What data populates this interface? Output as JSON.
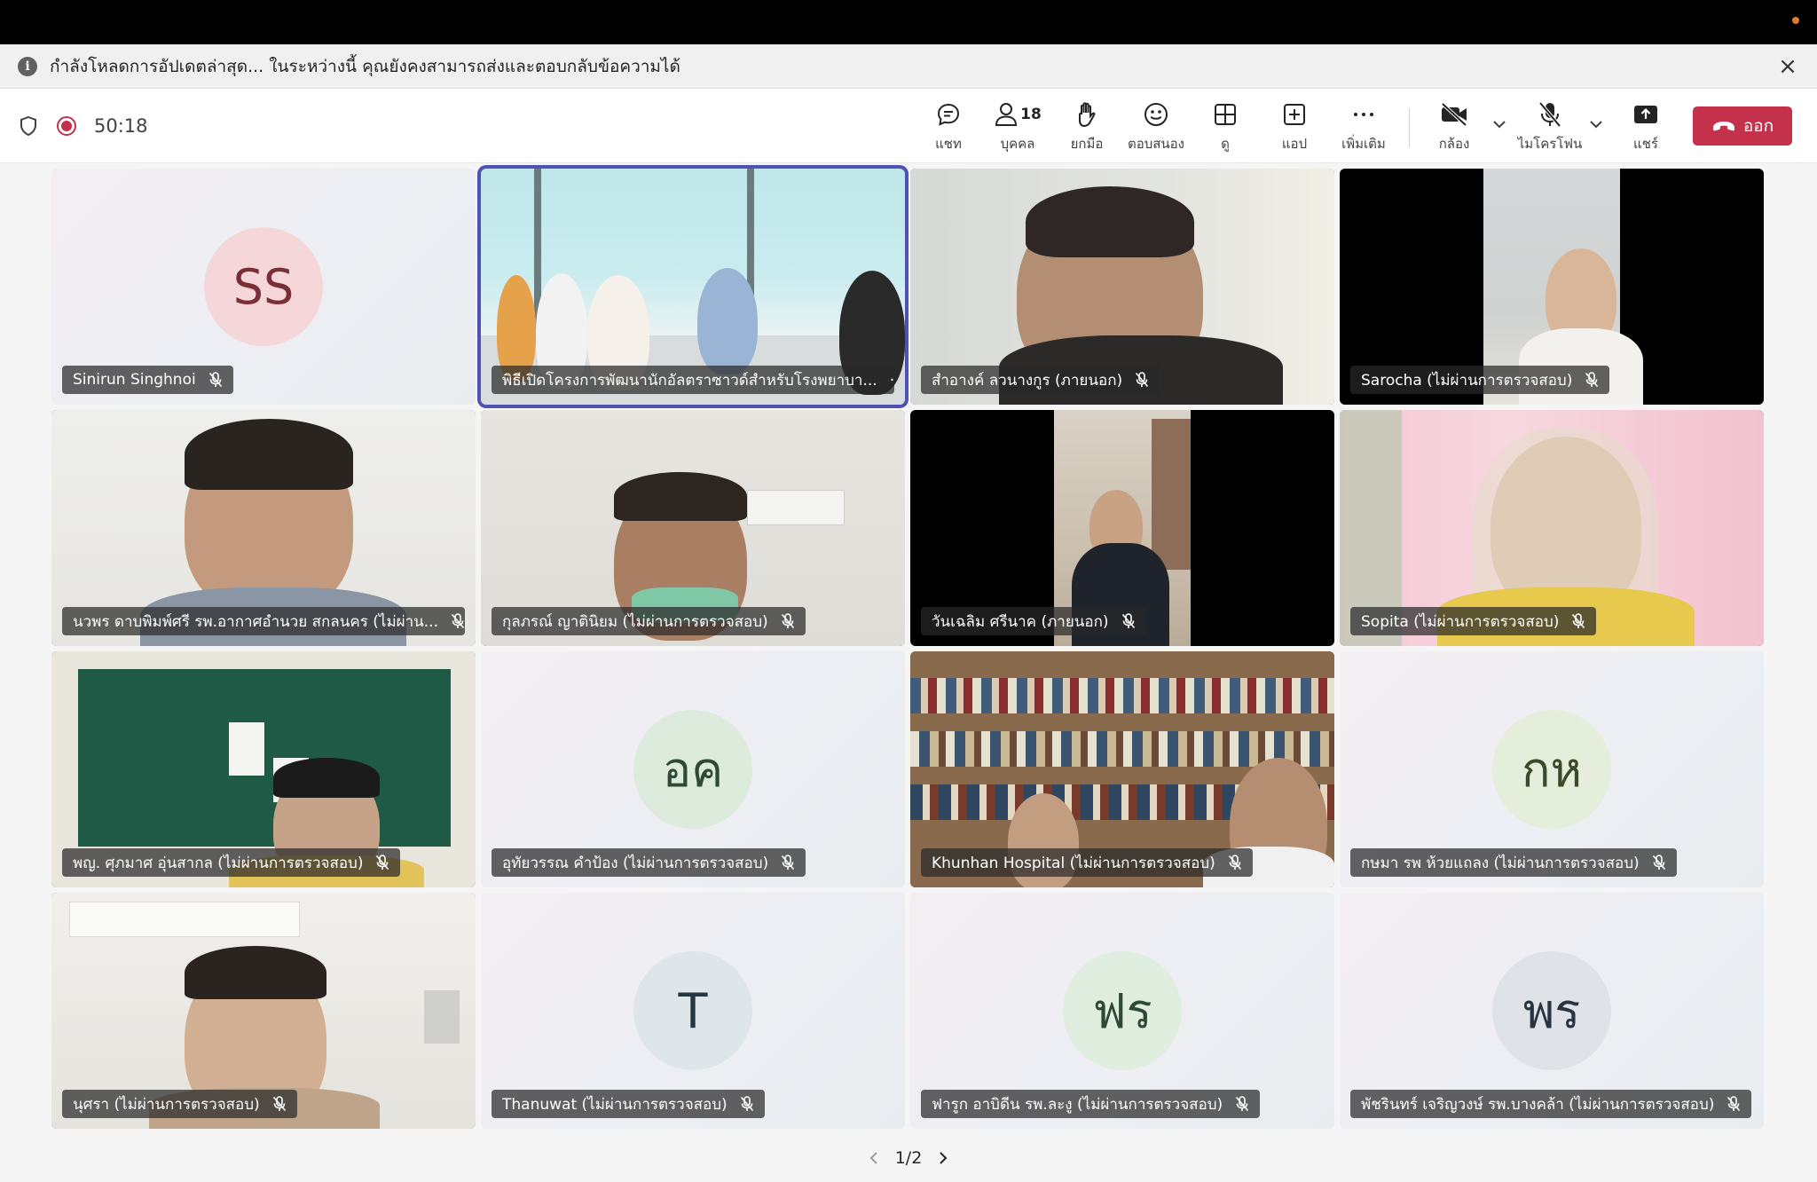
{
  "banner": {
    "message": "กำลังโหลดการอัปเดตล่าสุด... ในระหว่างนี้ คุณยังคงสามารถส่งและตอบกลับข้อความได้"
  },
  "meeting": {
    "timer": "50:18",
    "participant_count": "18"
  },
  "toolbar": {
    "chat": "แชท",
    "people": "บุคคล",
    "raise": "ยกมือ",
    "react": "ตอบสนอง",
    "view": "ดู",
    "apps": "แอป",
    "more": "เพิ่มเติม",
    "camera": "กล้อง",
    "mic": "ไมโครโฟน",
    "share": "แชร์",
    "leave": "ออก"
  },
  "tiles": [
    {
      "name": "Sinirun Singhnoi",
      "initials": "SS",
      "avatar_bg": "#f6d7d9",
      "avatar_fg": "#7a2e36"
    },
    {
      "name": "พิธีเปิดโครงการพัฒนานักอัลตราซาวด์สำหรับโรงพยาบา...",
      "more": "···"
    },
    {
      "name": "สำอางค์ ลวนางกูร (ภายนอก)"
    },
    {
      "name": "Sarocha (ไม่ผ่านการตรวจสอบ)"
    },
    {
      "name": "นวพร ดาบพิมพ์ศรี รพ.อากาศอำนวย สกลนคร (ไม่ผ่าน..."
    },
    {
      "name": "กุลภรณ์ ญาตินิยม (ไม่ผ่านการตรวจสอบ)"
    },
    {
      "name": "วันเฉลิม ศรีนาค (ภายนอก)"
    },
    {
      "name": "Sopita (ไม่ผ่านการตรวจสอบ)"
    },
    {
      "name": "พญ. ศุภมาศ อุ่นสากล (ไม่ผ่านการตรวจสอบ)"
    },
    {
      "name": "อุทัยวรรณ คำป้อง (ไม่ผ่านการตรวจสอบ)",
      "initials": "อค",
      "avatar_bg": "#dcebdc",
      "avatar_fg": "#2e4a35"
    },
    {
      "name": "Khunhan Hospital (ไม่ผ่านการตรวจสอบ)"
    },
    {
      "name": "กษมา รพ ห้วยแถลง (ไม่ผ่านการตรวจสอบ)",
      "initials": "กห",
      "avatar_bg": "#e5eedb",
      "avatar_fg": "#3a4a2a"
    },
    {
      "name": "นุศรา (ไม่ผ่านการตรวจสอบ)"
    },
    {
      "name": "Thanuwat (ไม่ผ่านการตรวจสอบ)",
      "initials": "T",
      "avatar_bg": "#dfe6ea",
      "avatar_fg": "#263640"
    },
    {
      "name": "ฟารูก อาบิดีน รพ.ละงู (ไม่ผ่านการตรวจสอบ)",
      "initials": "ฟร",
      "avatar_bg": "#dfeedf",
      "avatar_fg": "#2e4a35"
    },
    {
      "name": "พัชรินทร์ เจริญวงษ์ รพ.บางคล้า (ไม่ผ่านการตรวจสอบ)",
      "initials": "พร",
      "avatar_bg": "#dfe3e8",
      "avatar_fg": "#2a3440"
    }
  ],
  "pager": {
    "label": "1/2"
  },
  "colors": {
    "accent": "#4f52b2",
    "leave": "#c4314b",
    "record": "#c4314b"
  }
}
